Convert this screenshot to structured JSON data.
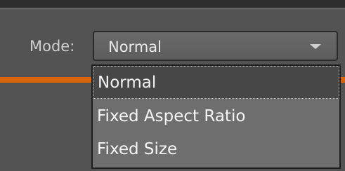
{
  "mode": {
    "label": "Mode:",
    "selected": "Normal"
  },
  "dropdown": {
    "options": [
      "Normal",
      "Fixed Aspect Ratio",
      "Fixed Size"
    ]
  },
  "colors": {
    "accent": "#d8650c",
    "panel": "#535353"
  }
}
